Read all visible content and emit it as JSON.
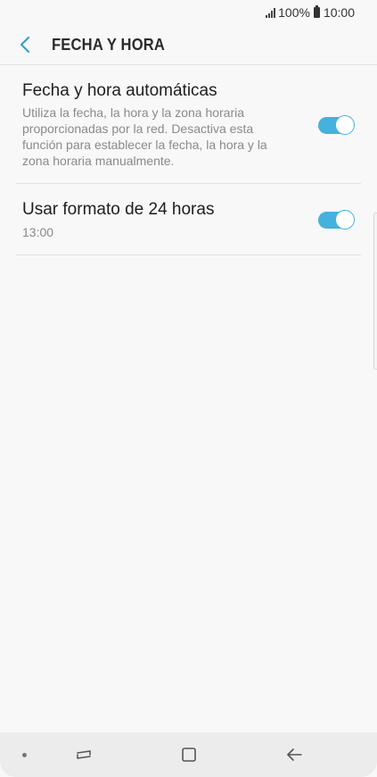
{
  "status_bar": {
    "battery_percent": "100%",
    "time": "10:00"
  },
  "header": {
    "title": "FECHA Y HORA",
    "back_icon": "chevron-left-icon"
  },
  "settings": [
    {
      "title": "Fecha y hora automáticas",
      "subtitle": "Utiliza la fecha, la hora y la zona horaria proporcionadas por la red. Desactiva esta función para establecer la fecha, la hora y la zona horaria manualmente.",
      "toggle_on": true
    },
    {
      "title": "Usar formato de 24 horas",
      "subtitle": "13:00",
      "toggle_on": true
    }
  ],
  "nav_bar": {
    "icons": [
      "recent-apps-icon",
      "home-icon",
      "back-arrow-icon"
    ]
  },
  "colors": {
    "accent": "#44b2dd",
    "background": "#f8f8f8",
    "nav_background": "#ececec"
  }
}
